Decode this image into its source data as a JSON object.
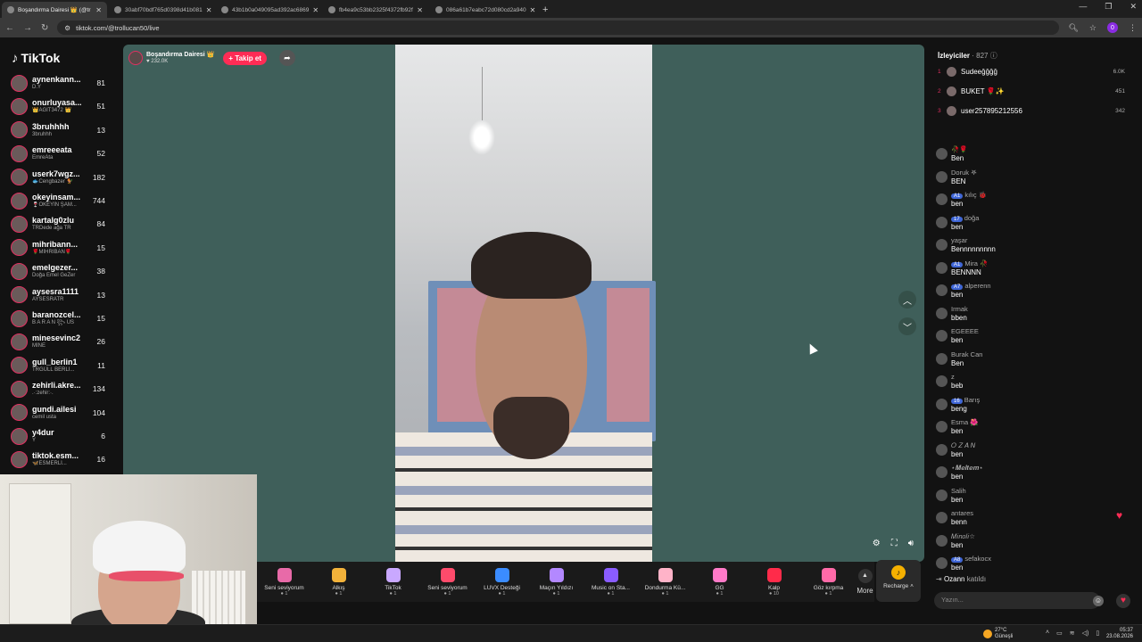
{
  "browser": {
    "tabs": [
      {
        "title": "Boşandırma Dairesi 👑 (@tr"
      },
      {
        "title": "30abf70bdf765d0398d41b081"
      },
      {
        "title": "43b1b0a049095ad392ac6869"
      },
      {
        "title": "fb4ea9c53bb2325f4372fb92f"
      },
      {
        "title": "086a61b7eabc72d080cd2a940"
      }
    ],
    "url": "tiktok.com/@trollucan50/live",
    "profile_initial": "0"
  },
  "sidebar": {
    "logo": "TikTok",
    "users": [
      {
        "name": "aynenkann...",
        "sub": "D.Y",
        "count": "81"
      },
      {
        "name": "onurluyasa...",
        "sub": "👑AGİT3472 👑",
        "count": "51"
      },
      {
        "name": "3bruhhhh",
        "sub": "3bruhhh",
        "count": "13"
      },
      {
        "name": "emreeeata",
        "sub": "EmreAta",
        "count": "52"
      },
      {
        "name": "userk7wgz...",
        "sub": "🐟Cengbazer 🐓",
        "count": "182"
      },
      {
        "name": "okeyinsam...",
        "sub": "🍷OKEYİN ŞAM...",
        "count": "744"
      },
      {
        "name": "kartalg0zlu",
        "sub": "TRDede ağa TR",
        "count": "84"
      },
      {
        "name": "mihribann...",
        "sub": "🌹MİHRİBAN🌹",
        "count": "15"
      },
      {
        "name": "emelgezer...",
        "sub": "Doğa Emel GeZer",
        "count": "38"
      },
      {
        "name": "aysesra1111",
        "sub": "AYSESRATR",
        "count": "13"
      },
      {
        "name": "baranozcel...",
        "sub": "B A R A N ꧂ US",
        "count": "15"
      },
      {
        "name": "minesevinc2",
        "sub": "MİNE",
        "count": "26"
      },
      {
        "name": "gull_berlin1",
        "sub": "TRGÜLL BERLİ...",
        "count": "11"
      },
      {
        "name": "zehirli.akre...",
        "sub": ".·:zehir:·.",
        "count": "134"
      },
      {
        "name": "gundi.ailesi",
        "sub": "cemil usta",
        "count": "104"
      },
      {
        "name": "y4dur",
        "sub": "Y",
        "count": "6"
      },
      {
        "name": "tiktok.esm...",
        "sub": "🦋ESMERLİ...",
        "count": "16"
      }
    ]
  },
  "live": {
    "host_name": "Boşandırma Dairesi 👑",
    "host_viewers": "232.0K",
    "follow_label": "+ Takip et",
    "share_icon": "share-icon"
  },
  "gifts": {
    "items": [
      {
        "name": "Seni seviyorum",
        "price": "1",
        "color": "#e86aa8"
      },
      {
        "name": "Alkış",
        "price": "1",
        "color": "#f2b23a"
      },
      {
        "name": "TikTok",
        "price": "1",
        "color": "#c9a8ff"
      },
      {
        "name": "Seni seviyorum",
        "price": "1",
        "color": "#ff4b6b"
      },
      {
        "name": "LUVX Desteği",
        "price": "1",
        "color": "#3b8cff"
      },
      {
        "name": "Maçın Yıldızı",
        "price": "1",
        "color": "#b388ff"
      },
      {
        "name": "Music on Sta...",
        "price": "1",
        "color": "#8a5cff"
      },
      {
        "name": "Dondurma Kü...",
        "price": "1",
        "color": "#ffb3c8"
      },
      {
        "name": "GG",
        "price": "1",
        "color": "#ff7ac8"
      },
      {
        "name": "Kalp",
        "price": "10",
        "color": "#ff2b4a"
      },
      {
        "name": "Göz kırpma",
        "price": "1",
        "color": "#ff6aa8"
      }
    ],
    "more_label": "More",
    "recharge_label": "Recharge"
  },
  "rightpanel": {
    "viewers_title": "İzleyiciler",
    "viewers_count": "· 827",
    "top_viewers": [
      {
        "rank": "1",
        "name": "Sudeeğğğğ",
        "score": "6.0K"
      },
      {
        "rank": "2",
        "name": "BUKET 🌹✨",
        "score": "451"
      },
      {
        "rank": "3",
        "name": "user257895212556",
        "score": "342"
      }
    ],
    "chat": [
      {
        "user": "🥀🌹",
        "badge": "",
        "text": "Ben"
      },
      {
        "user": "Doruk 𖤐",
        "badge": "",
        "text": "BEN"
      },
      {
        "user": "kılıç 🐞",
        "badge": "A1",
        "text": "ben"
      },
      {
        "user": "doğa",
        "badge": "17",
        "text": "ben"
      },
      {
        "user": "yaşar",
        "badge": "",
        "text": "Bennnnnnnnn"
      },
      {
        "user": "Mira 🥀",
        "badge": "A1",
        "text": "BENNNN"
      },
      {
        "user": "alperenn",
        "badge": "A7",
        "text": "ben"
      },
      {
        "user": "Irmak",
        "badge": "",
        "text": "bben"
      },
      {
        "user": "EGEEEE",
        "badge": "",
        "text": "ben"
      },
      {
        "user": "Burak Can",
        "badge": "",
        "text": "Ben"
      },
      {
        "user": "z",
        "badge": "",
        "text": "beb"
      },
      {
        "user": "Barış",
        "badge": "16",
        "text": "beng"
      },
      {
        "user": "Esma 🌺",
        "badge": "",
        "text": "ben"
      },
      {
        "user": "𝑂 𝑍 𝐴 𝑁",
        "badge": "",
        "text": "ben"
      },
      {
        "user": "⋆𝑴𝒆𝒍𝒕𝒆𝒎⋆",
        "badge": "",
        "text": "ben"
      },
      {
        "user": "Salih",
        "badge": "",
        "text": "ben"
      },
      {
        "user": "antares",
        "badge": "",
        "text": "benn"
      },
      {
        "user": "𝑀𝑖𝑛𝑜𝑙𝑖☆",
        "badge": "",
        "text": "ben"
      },
      {
        "user": "sefakocx",
        "badge": "A8",
        "text": "ben"
      }
    ],
    "joined_user": "Ozann",
    "joined_text": "katıldı",
    "chat_placeholder": "Yazın..."
  },
  "taskbar": {
    "temperature": "27°C",
    "weather_text": "Güneşli",
    "time": "05:37",
    "date": "23.08.2026"
  }
}
